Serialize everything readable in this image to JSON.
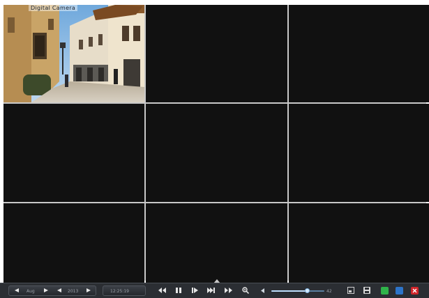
{
  "camera": {
    "label": "Digital Camera"
  },
  "grid": {
    "columns": 3,
    "rows": 3,
    "active_channel": 1
  },
  "toolbar": {
    "month": "Aug",
    "year": "2013",
    "time": "12:25:19",
    "volume_value": "42",
    "volume_fraction": 0.68
  },
  "colors": {
    "toolbar_bg": "#2b2e33",
    "green_button": "#2fb34a",
    "blue_button": "#2d74c9",
    "red_button": "#d0262b",
    "volume_accent": "#bfe0ff"
  },
  "icons": [
    "prev-month-arrow-icon",
    "next-month-arrow-icon",
    "prev-year-arrow-icon",
    "next-year-arrow-icon",
    "rewind-icon",
    "pause-icon",
    "step-forward-icon",
    "skip-end-icon",
    "fast-forward-icon",
    "zoom-icon",
    "volume-left-icon",
    "snapshot-icon",
    "save-icon",
    "green-status-icon",
    "blue-status-icon",
    "close-icon"
  ]
}
